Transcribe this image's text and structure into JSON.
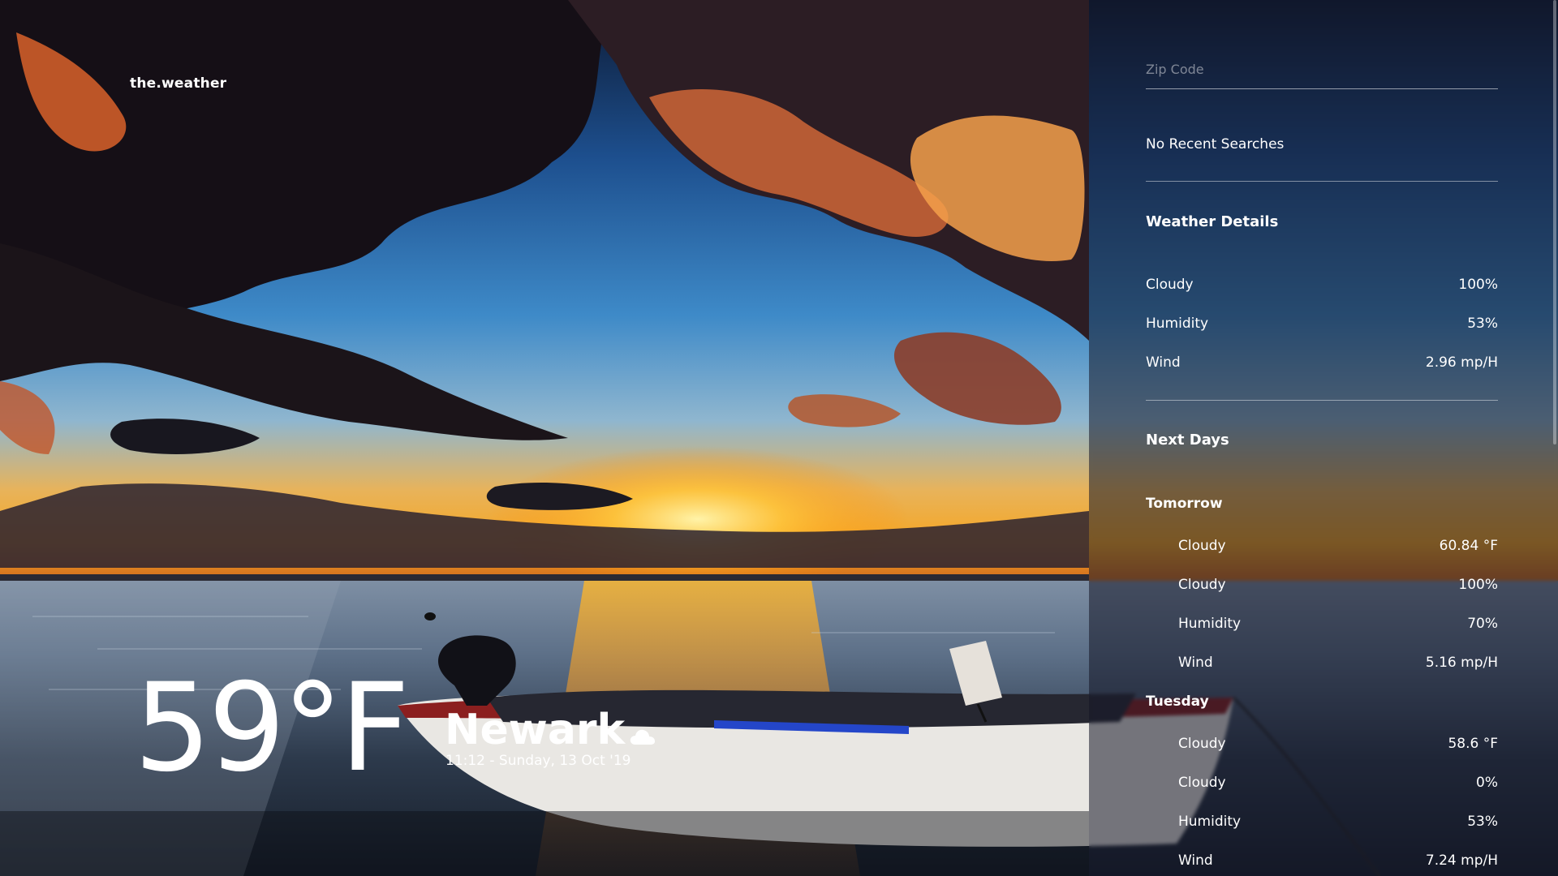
{
  "app": {
    "brand": "the.weather"
  },
  "current": {
    "temperature": "59°F",
    "city": "Newark",
    "datetime": "11:12 - Sunday, 13 Oct '19",
    "condition_icon": "cloud-icon"
  },
  "search": {
    "placeholder": "Zip Code",
    "value": "",
    "recent_label": "No Recent Searches"
  },
  "details": {
    "title": "Weather Details",
    "rows": [
      {
        "label": "Cloudy",
        "value": "100%"
      },
      {
        "label": "Humidity",
        "value": "53%"
      },
      {
        "label": "Wind",
        "value": "2.96 mp/H"
      }
    ]
  },
  "next_days": {
    "title": "Next Days",
    "days": [
      {
        "name": "Tomorrow",
        "rows": [
          {
            "label": "Cloudy",
            "value": "60.84 °F"
          },
          {
            "label": "Cloudy",
            "value": "100%"
          },
          {
            "label": "Humidity",
            "value": "70%"
          },
          {
            "label": "Wind",
            "value": "5.16 mp/H"
          }
        ]
      },
      {
        "name": "Tuesday",
        "rows": [
          {
            "label": "Cloudy",
            "value": "58.6 °F"
          },
          {
            "label": "Cloudy",
            "value": "0%"
          },
          {
            "label": "Humidity",
            "value": "53%"
          },
          {
            "label": "Wind",
            "value": "7.24 mp/H"
          }
        ]
      }
    ]
  }
}
